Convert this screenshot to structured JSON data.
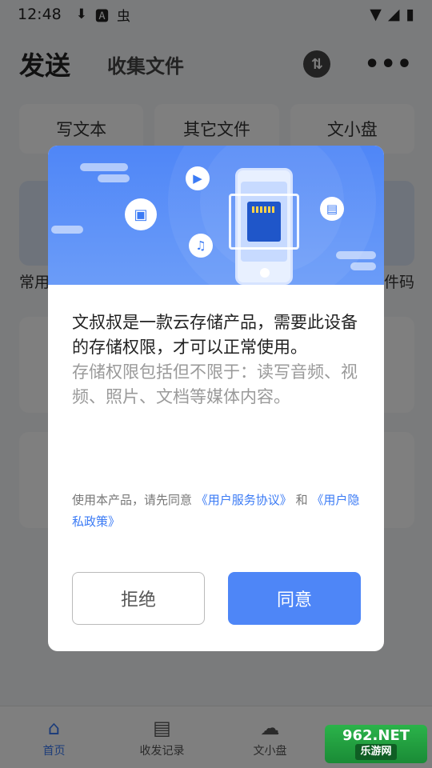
{
  "status_bar": {
    "time": "12:48",
    "icons": [
      "download-icon",
      "a-icon",
      "bug-icon"
    ],
    "right_icons": [
      "wifi-icon",
      "signal-icon",
      "battery-icon"
    ]
  },
  "header": {
    "title": "发送",
    "tab_collect": "收集文件"
  },
  "quick_actions": [
    "写文本",
    "其它文件",
    "文小盘"
  ],
  "section_labels": {
    "common": "常用",
    "pickup": "件码"
  },
  "dialog": {
    "main_text": "文叔叔是一款云存储产品，需要此设备的存储权限，才可以正常使用。",
    "sub_text": "存储权限包括但不限于：读写音频、视频、照片、文档等媒体内容。",
    "agree_prefix": "使用本产品，请先同意 ",
    "agreement_link": "《用户服务协议》",
    "agree_and": " 和 ",
    "privacy_link": "《用户隐私政策》",
    "reject_button": "拒绝",
    "agree_button": "同意"
  },
  "tab_bar": [
    {
      "label": "首页",
      "icon": "home-icon",
      "active": true
    },
    {
      "label": "收发记录",
      "icon": "clipboard-icon",
      "active": false
    },
    {
      "label": "文小盘",
      "icon": "cloud-icon",
      "active": false
    },
    {
      "label": "",
      "icon": "user-icon",
      "active": false
    }
  ],
  "watermark": {
    "line1": "962.NET",
    "line2": "乐游网"
  },
  "colors": {
    "accent": "#4e86f7",
    "overlay": "rgba(0,0,0,0.5)"
  }
}
